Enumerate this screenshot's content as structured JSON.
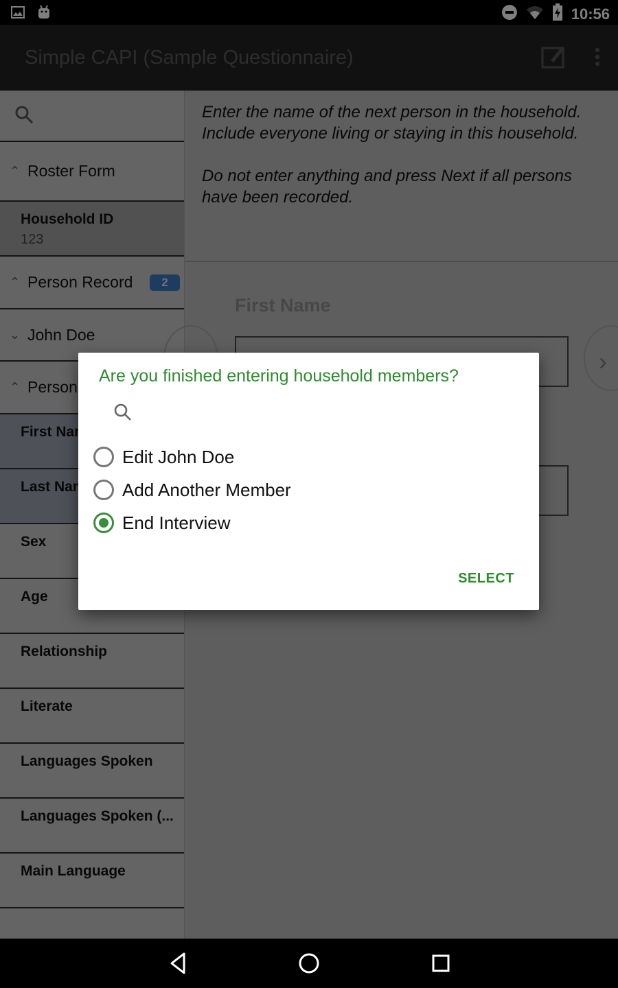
{
  "status_bar": {
    "time": "10:56",
    "left_icons": [
      "image-notification-icon",
      "android-notification-icon"
    ],
    "right_icons": [
      "do-not-disturb-icon",
      "wifi-icon",
      "battery-charging-icon"
    ]
  },
  "app_bar": {
    "title": "Simple CAPI (Sample Questionnaire)",
    "actions": [
      "edit-note-icon",
      "overflow-menu-icon"
    ]
  },
  "sidebar": {
    "search_icon": "search-icon",
    "items": [
      {
        "type": "group",
        "label": "Roster Form",
        "expanded": true
      },
      {
        "type": "field",
        "label": "Household ID",
        "value": "123"
      },
      {
        "type": "group",
        "label": "Person Record",
        "expanded": true,
        "badge": "2"
      },
      {
        "type": "group",
        "label": "John Doe",
        "expanded": false
      },
      {
        "type": "group",
        "label": "Person Record",
        "expanded": true
      },
      {
        "type": "field",
        "label": "First Name",
        "current": true
      },
      {
        "type": "field",
        "label": "Last Name",
        "current": true
      },
      {
        "type": "field",
        "label": "Sex"
      },
      {
        "type": "field",
        "label": "Age"
      },
      {
        "type": "field",
        "label": "Relationship"
      },
      {
        "type": "field",
        "label": "Literate"
      },
      {
        "type": "field",
        "label": "Languages Spoken"
      },
      {
        "type": "field",
        "label": "Languages Spoken (..."
      },
      {
        "type": "field",
        "label": "Main Language"
      }
    ]
  },
  "main": {
    "question_text": [
      "Enter the name of the next person in the household. Include everyone living or staying in this household.",
      "Do not enter anything and press Next if all persons have been recorded."
    ],
    "field_label": "First Name",
    "first_input_value": "",
    "second_input_value": "",
    "prev_icon": "chevron-left-icon",
    "next_icon": "chevron-right-icon"
  },
  "dialog": {
    "title": "Are you finished entering household members?",
    "search_icon": "search-icon",
    "options": [
      {
        "label": "Edit John Doe",
        "selected": false
      },
      {
        "label": "Add Another Member",
        "selected": false
      },
      {
        "label": "End Interview",
        "selected": true
      }
    ],
    "select_label": "SELECT",
    "accent_color": "#2e8b2e"
  },
  "nav_bar": {
    "buttons": [
      "back-icon",
      "home-icon",
      "recents-icon"
    ]
  }
}
